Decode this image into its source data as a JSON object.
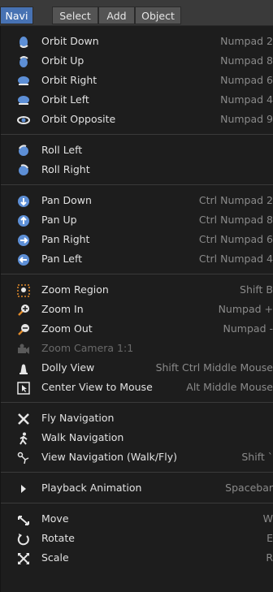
{
  "menubar": {
    "tabs": [
      {
        "label": "Navi",
        "active": true
      },
      {
        "label": "Select",
        "active": false
      },
      {
        "label": "Add",
        "active": false
      },
      {
        "label": "Object",
        "active": false
      }
    ]
  },
  "menu": {
    "items": [
      {
        "label": "Orbit Down",
        "shortcut": "Numpad 2",
        "icon": "orbit-down-icon",
        "enabled": true
      },
      {
        "label": "Orbit Up",
        "shortcut": "Numpad 8",
        "icon": "orbit-up-icon",
        "enabled": true
      },
      {
        "label": "Orbit Right",
        "shortcut": "Numpad 6",
        "icon": "orbit-right-icon",
        "enabled": true
      },
      {
        "label": "Orbit Left",
        "shortcut": "Numpad 4",
        "icon": "orbit-left-icon",
        "enabled": true
      },
      {
        "label": "Orbit Opposite",
        "shortcut": "Numpad 9",
        "icon": "orbit-opposite-icon",
        "enabled": true
      },
      {
        "label": "Roll Left",
        "shortcut": "",
        "icon": "roll-left-icon",
        "enabled": true
      },
      {
        "label": "Roll Right",
        "shortcut": "",
        "icon": "roll-right-icon",
        "enabled": true
      },
      {
        "label": "Pan Down",
        "shortcut": "Ctrl Numpad 2",
        "icon": "pan-down-icon",
        "enabled": true
      },
      {
        "label": "Pan Up",
        "shortcut": "Ctrl Numpad 8",
        "icon": "pan-up-icon",
        "enabled": true
      },
      {
        "label": "Pan Right",
        "shortcut": "Ctrl Numpad 6",
        "icon": "pan-right-icon",
        "enabled": true
      },
      {
        "label": "Pan Left",
        "shortcut": "Ctrl Numpad 4",
        "icon": "pan-left-icon",
        "enabled": true
      },
      {
        "label": "Zoom Region",
        "shortcut": "Shift B",
        "icon": "zoom-region-icon",
        "enabled": true
      },
      {
        "label": "Zoom In",
        "shortcut": "Numpad +",
        "icon": "zoom-in-icon",
        "enabled": true
      },
      {
        "label": "Zoom Out",
        "shortcut": "Numpad -",
        "icon": "zoom-out-icon",
        "enabled": true
      },
      {
        "label": "Zoom Camera 1:1",
        "shortcut": "",
        "icon": "zoom-camera-icon",
        "enabled": false
      },
      {
        "label": "Dolly View",
        "shortcut": "Shift Ctrl Middle Mouse",
        "icon": "dolly-view-icon",
        "enabled": true
      },
      {
        "label": "Center View to Mouse",
        "shortcut": "Alt Middle Mouse",
        "icon": "center-view-icon",
        "enabled": true
      },
      {
        "label": "Fly Navigation",
        "shortcut": "",
        "icon": "fly-navigation-icon",
        "enabled": true
      },
      {
        "label": "Walk Navigation",
        "shortcut": "",
        "icon": "walk-navigation-icon",
        "enabled": true
      },
      {
        "label": "View Navigation (Walk/Fly)",
        "shortcut": "Shift `",
        "icon": "view-navigation-icon",
        "enabled": true
      },
      {
        "label": "Playback Animation",
        "shortcut": "Spacebar",
        "icon": "play-icon",
        "enabled": true
      },
      {
        "label": "Move",
        "shortcut": "W",
        "icon": "move-icon",
        "enabled": true
      },
      {
        "label": "Rotate",
        "shortcut": "E",
        "icon": "rotate-icon",
        "enabled": true
      },
      {
        "label": "Scale",
        "shortcut": "R",
        "icon": "scale-icon",
        "enabled": true
      }
    ]
  },
  "colors": {
    "accent": "#4772b3",
    "menu_bg": "#1d1d1d",
    "text": "#e1e1e1",
    "shortcut_text": "#8a8a8a",
    "disabled_text": "#6a6a6a",
    "icon_blue": "#5d8fd6",
    "icon_orange": "#e08a2a",
    "icon_white": "#e6e6e6"
  }
}
